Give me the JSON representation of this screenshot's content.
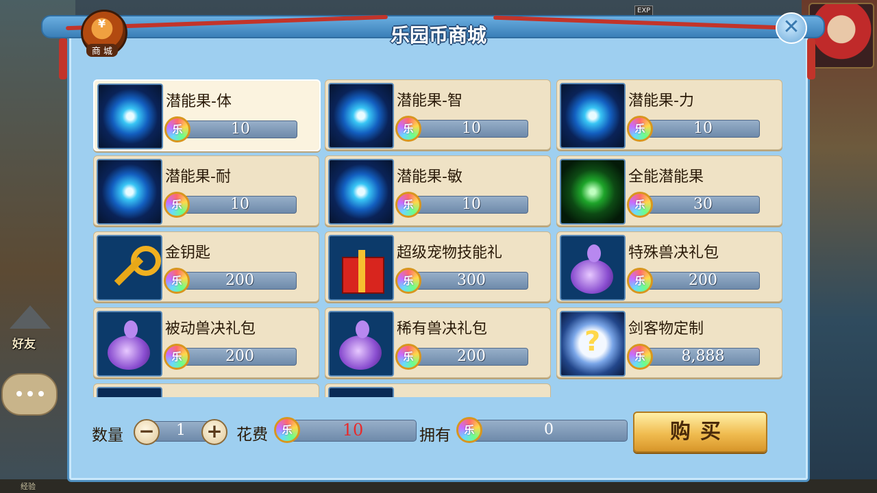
{
  "header": {
    "title": "乐园币商城",
    "shop_icon_label": "商 城",
    "exp_tag": "EXP"
  },
  "background": {
    "left_labels": [
      "好友"
    ],
    "bottom_text": "经验"
  },
  "items": [
    {
      "name": "潜能果-体",
      "price": "10",
      "icon": "blue-orb",
      "selected": true
    },
    {
      "name": "潜能果-智",
      "price": "10",
      "icon": "blue-orb"
    },
    {
      "name": "潜能果-力",
      "price": "10",
      "icon": "blue-orb"
    },
    {
      "name": "潜能果-耐",
      "price": "10",
      "icon": "blue-orb"
    },
    {
      "name": "潜能果-敏",
      "price": "10",
      "icon": "blue-orb"
    },
    {
      "name": "全能潜能果",
      "price": "30",
      "icon": "green-orb"
    },
    {
      "name": "金钥匙",
      "price": "200",
      "icon": "key"
    },
    {
      "name": "超级宠物技能礼",
      "price": "300",
      "icon": "gift"
    },
    {
      "name": "特殊兽决礼包",
      "price": "200",
      "icon": "bag"
    },
    {
      "name": "被动兽决礼包",
      "price": "200",
      "icon": "bag"
    },
    {
      "name": "稀有兽决礼包",
      "price": "200",
      "icon": "bag"
    },
    {
      "name": "剑客物定制",
      "price": "8,888",
      "icon": "mystery"
    },
    {
      "name": "",
      "price": "",
      "icon": "dark"
    },
    {
      "name": "",
      "price": "",
      "icon": "dark"
    }
  ],
  "purchase": {
    "quantity_label": "数量",
    "quantity": "1",
    "cost_label": "花费",
    "cost": "10",
    "owned_label": "拥有",
    "owned": "0",
    "buy_label": "购买",
    "minus_symbol": "−",
    "plus_symbol": "+",
    "close_symbol": "✕"
  }
}
